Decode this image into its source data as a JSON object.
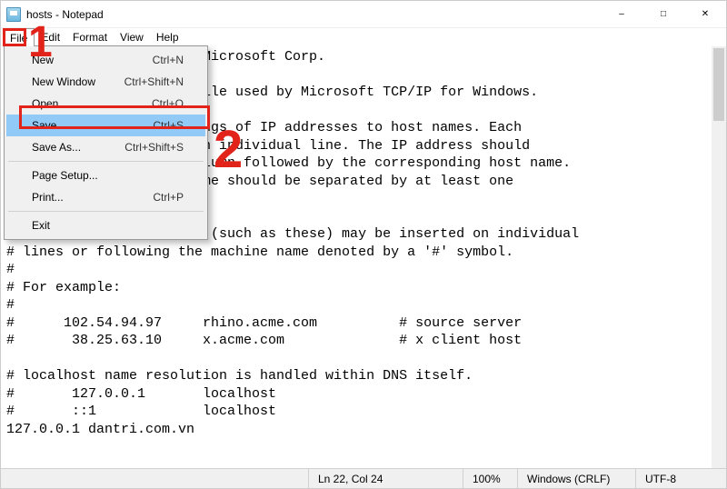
{
  "title": "hosts - Notepad",
  "menu": {
    "items": [
      "File",
      "Edit",
      "Format",
      "View",
      "Help"
    ]
  },
  "dropdown": {
    "items": [
      {
        "label": "New",
        "shortcut": "Ctrl+N"
      },
      {
        "label": "New Window",
        "shortcut": "Ctrl+Shift+N"
      },
      {
        "label": "Open...",
        "shortcut": "Ctrl+O"
      },
      {
        "label": "Save",
        "shortcut": "Ctrl+S",
        "highlight": true
      },
      {
        "label": "Save As...",
        "shortcut": "Ctrl+Shift+S"
      },
      {
        "sep": true
      },
      {
        "label": "Page Setup...",
        "shortcut": ""
      },
      {
        "label": "Print...",
        "shortcut": "Ctrl+P"
      },
      {
        "sep": true
      },
      {
        "label": "Exit",
        "shortcut": ""
      }
    ]
  },
  "editor_text": "                        Microsoft Corp.\n\n                        ile used by Microsoft TCP/IP for Windows.\n\n                        ngs of IP addresses to host names. Each\n                        n individual line. The IP address should\n                        lumn followed by the corresponding host name.\n                        me should be separated by at least one\n\n\n# Additionally, comments (such as these) may be inserted on individual\n# lines or following the machine name denoted by a '#' symbol.\n#\n# For example:\n#\n#      102.54.94.97     rhino.acme.com          # source server\n#       38.25.63.10     x.acme.com              # x client host\n\n# localhost name resolution is handled within DNS itself.\n#       127.0.0.1       localhost\n#       ::1             localhost\n127.0.0.1 dantri.com.vn\n",
  "status": {
    "position": "Ln 22, Col 24",
    "zoom": "100%",
    "line_ending": "Windows (CRLF)",
    "encoding": "UTF-8"
  },
  "annotations": {
    "num1": "1",
    "num2": "2"
  }
}
